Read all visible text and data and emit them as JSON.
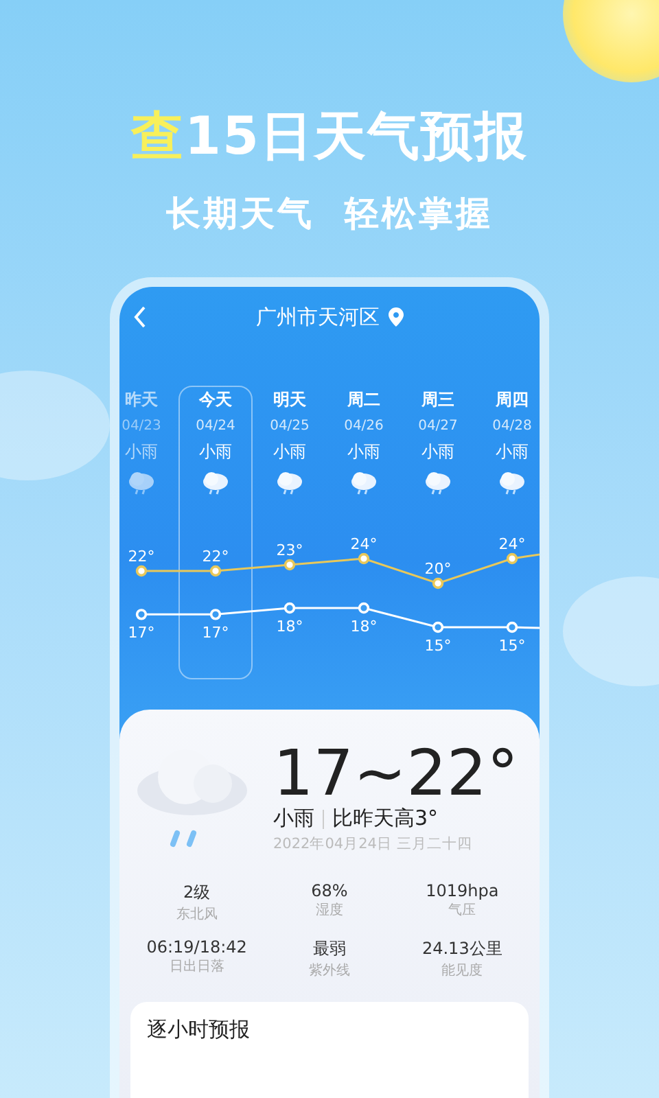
{
  "headline": {
    "highlight": "查",
    "rest": "15日天气预报"
  },
  "subtitle": [
    "长期天气",
    "轻松掌握"
  ],
  "location": {
    "title": "广州市天河区"
  },
  "days": [
    {
      "name": "昨天",
      "date": "04/23",
      "weather": "小雨",
      "high": "22°",
      "low": "17°",
      "past": true,
      "selected": false
    },
    {
      "name": "今天",
      "date": "04/24",
      "weather": "小雨",
      "high": "22°",
      "low": "17°",
      "past": false,
      "selected": true
    },
    {
      "name": "明天",
      "date": "04/25",
      "weather": "小雨",
      "high": "23°",
      "low": "18°",
      "past": false,
      "selected": false
    },
    {
      "name": "周二",
      "date": "04/26",
      "weather": "小雨",
      "high": "24°",
      "low": "18°",
      "past": false,
      "selected": false
    },
    {
      "name": "周三",
      "date": "04/27",
      "weather": "小雨",
      "high": "20°",
      "low": "15°",
      "past": false,
      "selected": false
    },
    {
      "name": "周四",
      "date": "04/28",
      "weather": "小雨",
      "high": "24°",
      "low": "15°",
      "past": false,
      "selected": false
    }
  ],
  "today": {
    "range": "17~22°",
    "weather": "小雨",
    "compare": "比昨天高3°",
    "date": "2022年04月24日  三月二十四"
  },
  "stats": [
    {
      "value": "2级",
      "label": "东北风"
    },
    {
      "value": "68%",
      "label": "湿度"
    },
    {
      "value": "1019hpa",
      "label": "气压"
    },
    {
      "value": "06:19/18:42",
      "label": "日出日落"
    },
    {
      "value": "最弱",
      "label": "紫外线"
    },
    {
      "value": "24.13公里",
      "label": "能见度"
    }
  ],
  "hourly": {
    "title": "逐小时预报"
  }
}
